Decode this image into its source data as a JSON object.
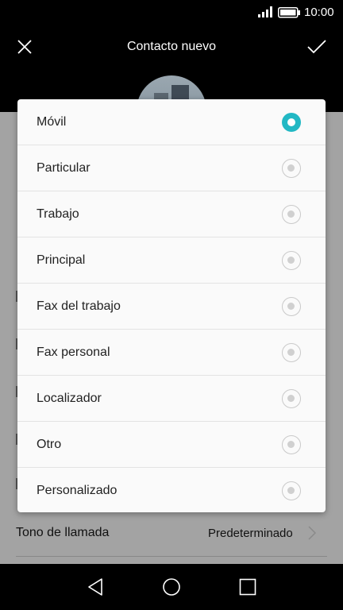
{
  "status_bar": {
    "time": "10:00"
  },
  "app_bar": {
    "title": "Contacto nuevo"
  },
  "background": {
    "ringtone_label": "Tono de llamada",
    "ringtone_value": "Predeterminado"
  },
  "dialog": {
    "selected": "Móvil",
    "options": [
      {
        "label": "Móvil"
      },
      {
        "label": "Particular"
      },
      {
        "label": "Trabajo"
      },
      {
        "label": "Principal"
      },
      {
        "label": "Fax del trabajo"
      },
      {
        "label": "Fax personal"
      },
      {
        "label": "Localizador"
      },
      {
        "label": "Otro"
      },
      {
        "label": "Personalizado"
      }
    ]
  },
  "colors": {
    "accent": "#22b8c4",
    "dim_background": "#a3a3a3",
    "dialog_background": "#fafafa"
  },
  "icons": [
    "signal-icon",
    "battery-icon",
    "close-icon",
    "check-icon",
    "chevron-right-icon",
    "back-icon",
    "home-icon",
    "recent-apps-icon"
  ]
}
